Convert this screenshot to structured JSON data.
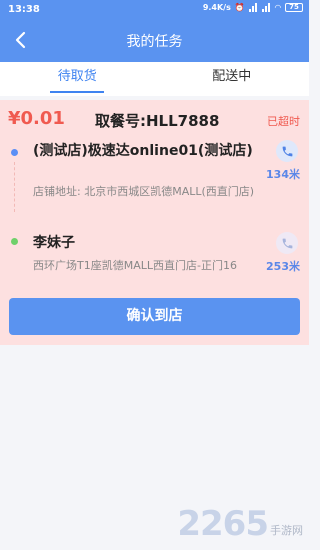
{
  "status_bar": {
    "time": "13:38",
    "network_speed": "9.4K/s",
    "battery": "75"
  },
  "header": {
    "title": "我的任务"
  },
  "tabs": [
    {
      "label": "待取货",
      "active": true
    },
    {
      "label": "配送中",
      "active": false
    }
  ],
  "order": {
    "price": "¥0.01",
    "pickup_code": "取餐号:HLL7888",
    "status": "已超时",
    "store": {
      "name": "(测试店)极速达online01(测试店)",
      "address": "店铺地址: 北京市西城区凯德MALL(西直门店)",
      "distance": "134米"
    },
    "customer": {
      "name": "李妹子",
      "address": "西环广场T1座凯德MALL西直门店-正门16",
      "distance": "253米"
    },
    "confirm_label": "确认到店"
  },
  "watermark": {
    "number": "2265",
    "text": "手游网"
  },
  "colors": {
    "primary": "#5a93f0",
    "card_bg": "#fde0e0",
    "alert": "#f05a50"
  }
}
